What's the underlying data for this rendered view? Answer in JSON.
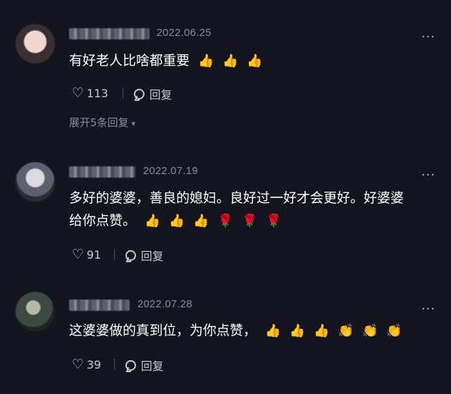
{
  "comments": [
    {
      "date": "2022.06.25",
      "text": "有好老人比啥都重要",
      "emojis": [
        "👍",
        "👍",
        "👍"
      ],
      "likes": "113",
      "reply_label": "回复",
      "expand_label": "展开5条回复"
    },
    {
      "date": "2022.07.19",
      "text_line1": "多好的婆婆，善良的媳妇。良好过一好才会更好。好婆婆",
      "text_line2": "给你点赞。",
      "emojis": [
        "👍",
        "👍",
        "👍",
        "🌹",
        "🌹",
        "🌹"
      ],
      "likes": "91",
      "reply_label": "回复"
    },
    {
      "date": "2022.07.28",
      "text": "这婆婆做的真到位，为你点赞，",
      "emojis": [
        "👍",
        "👍",
        "👍",
        "👏",
        "👏",
        "👏"
      ],
      "likes": "39",
      "reply_label": "回复"
    }
  ],
  "icons": {
    "more": "···",
    "heart": "♡",
    "chevron": "▾"
  }
}
